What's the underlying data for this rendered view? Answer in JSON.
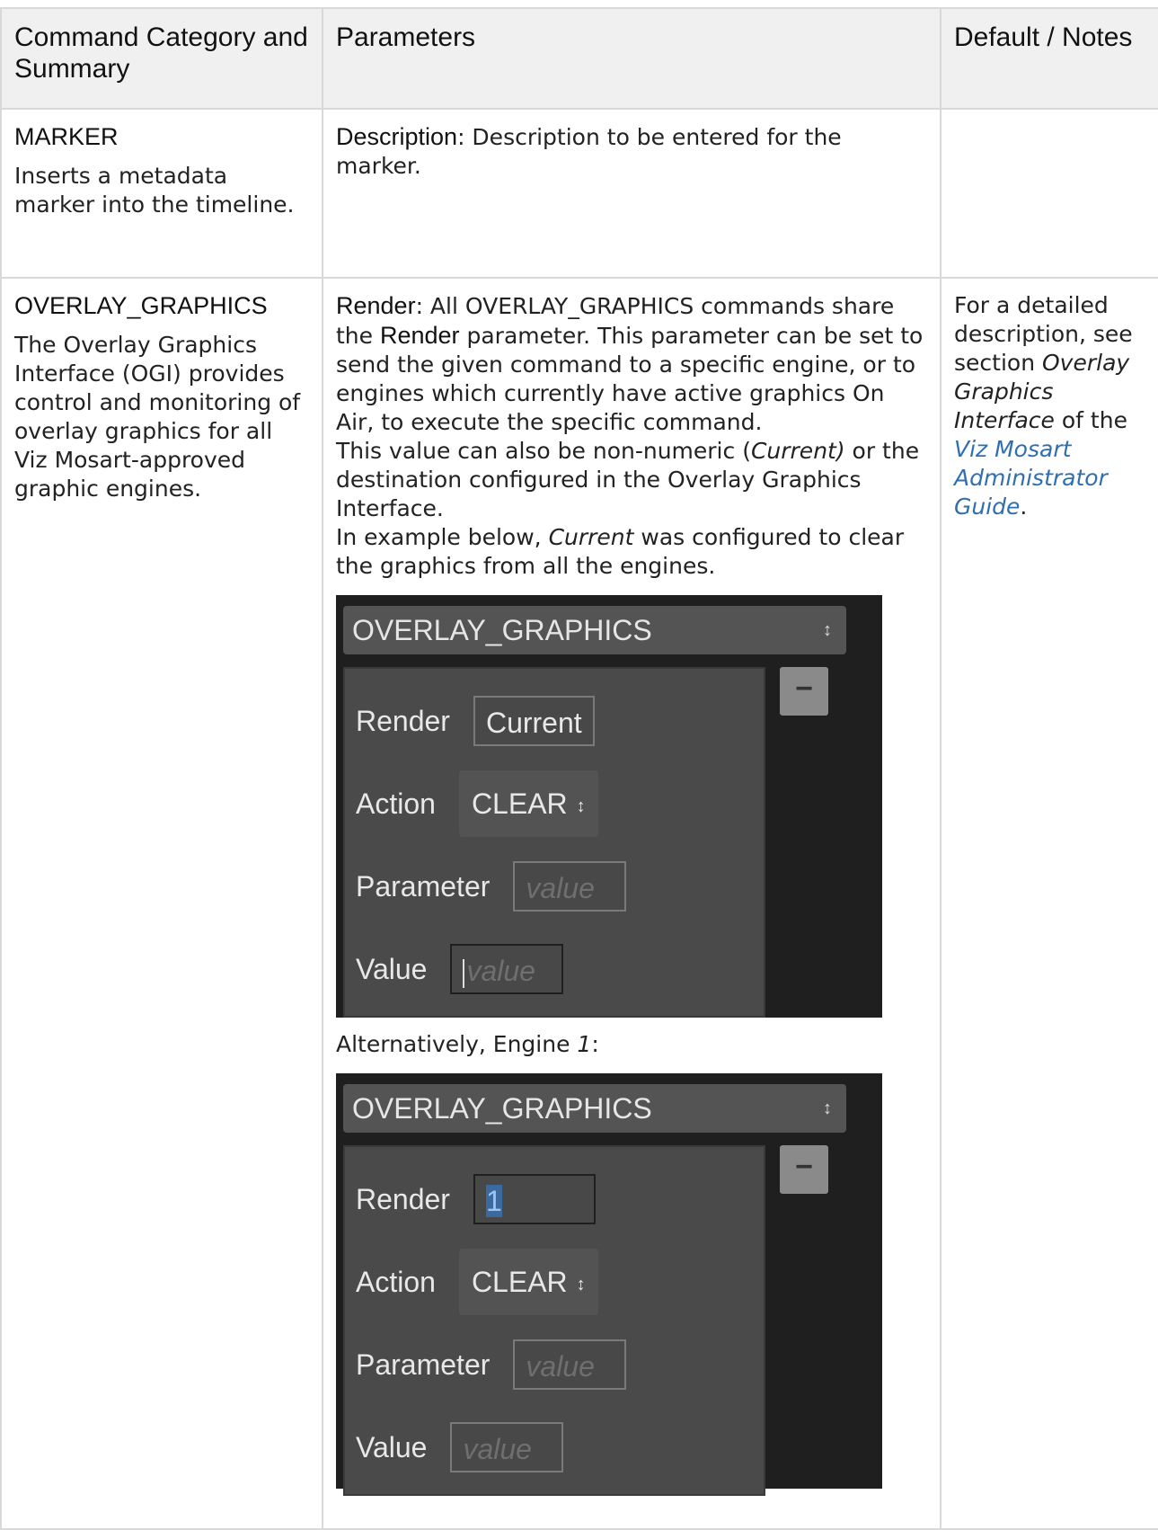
{
  "table": {
    "headers": [
      "Command Category and Summary",
      "Parameters",
      "Default / Notes"
    ],
    "rows": [
      {
        "category": "MARKER",
        "summary": "Inserts a metadata marker into the timeline.",
        "param_name": "Description",
        "param_text": ": Description to be entered for the marker.",
        "notes": ""
      },
      {
        "category": "OVERLAY_GRAPHICS",
        "summary": "The Overlay Graphics Interface (OGI) provides control and monitoring of overlay graphics for all Viz Mosart-approved graphic engines.",
        "render_label": "Render",
        "render_text_1": ": All OVERLAY_GRAPHICS commands share the ",
        "render_bold": "Render",
        "render_text_2": " parameter. This parameter can be set to send the given command to a specific engine, or to engines which currently have active graphics On Air, to execute the specific command.",
        "line2_a": "This value can also be non-numeric (",
        "line2_italic": "Current)",
        "line2_b": " or the destination configured in the Overlay Graphics Interface.",
        "line3_a": "In example below, ",
        "line3_italic": "Current",
        "line3_b": " was configured to clear the graphics from all the engines.",
        "alt_text_a": "Alternatively, Engine ",
        "alt_italic": "1",
        "alt_text_b": ":",
        "notes_a": "For a detailed description, see section ",
        "notes_italic": "Overlay Graphics Interface",
        "notes_b": " of the ",
        "notes_link": "Viz Mosart Administrator Guide",
        "notes_c": "."
      }
    ]
  },
  "panel1": {
    "dropdown": "OVERLAY_GRAPHICS",
    "render_label": "Render",
    "render_value": "Current",
    "action_label": "Action",
    "action_value": "CLEAR",
    "parameter_label": "Parameter",
    "parameter_placeholder": "value",
    "value_label": "Value",
    "value_placeholder": "value",
    "minus": "−"
  },
  "panel2": {
    "dropdown": "OVERLAY_GRAPHICS",
    "render_label": "Render",
    "render_value": "1",
    "action_label": "Action",
    "action_value": "CLEAR",
    "parameter_label": "Parameter",
    "parameter_placeholder": "value",
    "value_label": "Value",
    "value_placeholder": "value",
    "minus": "−"
  },
  "icons": {
    "updown": "↕"
  }
}
